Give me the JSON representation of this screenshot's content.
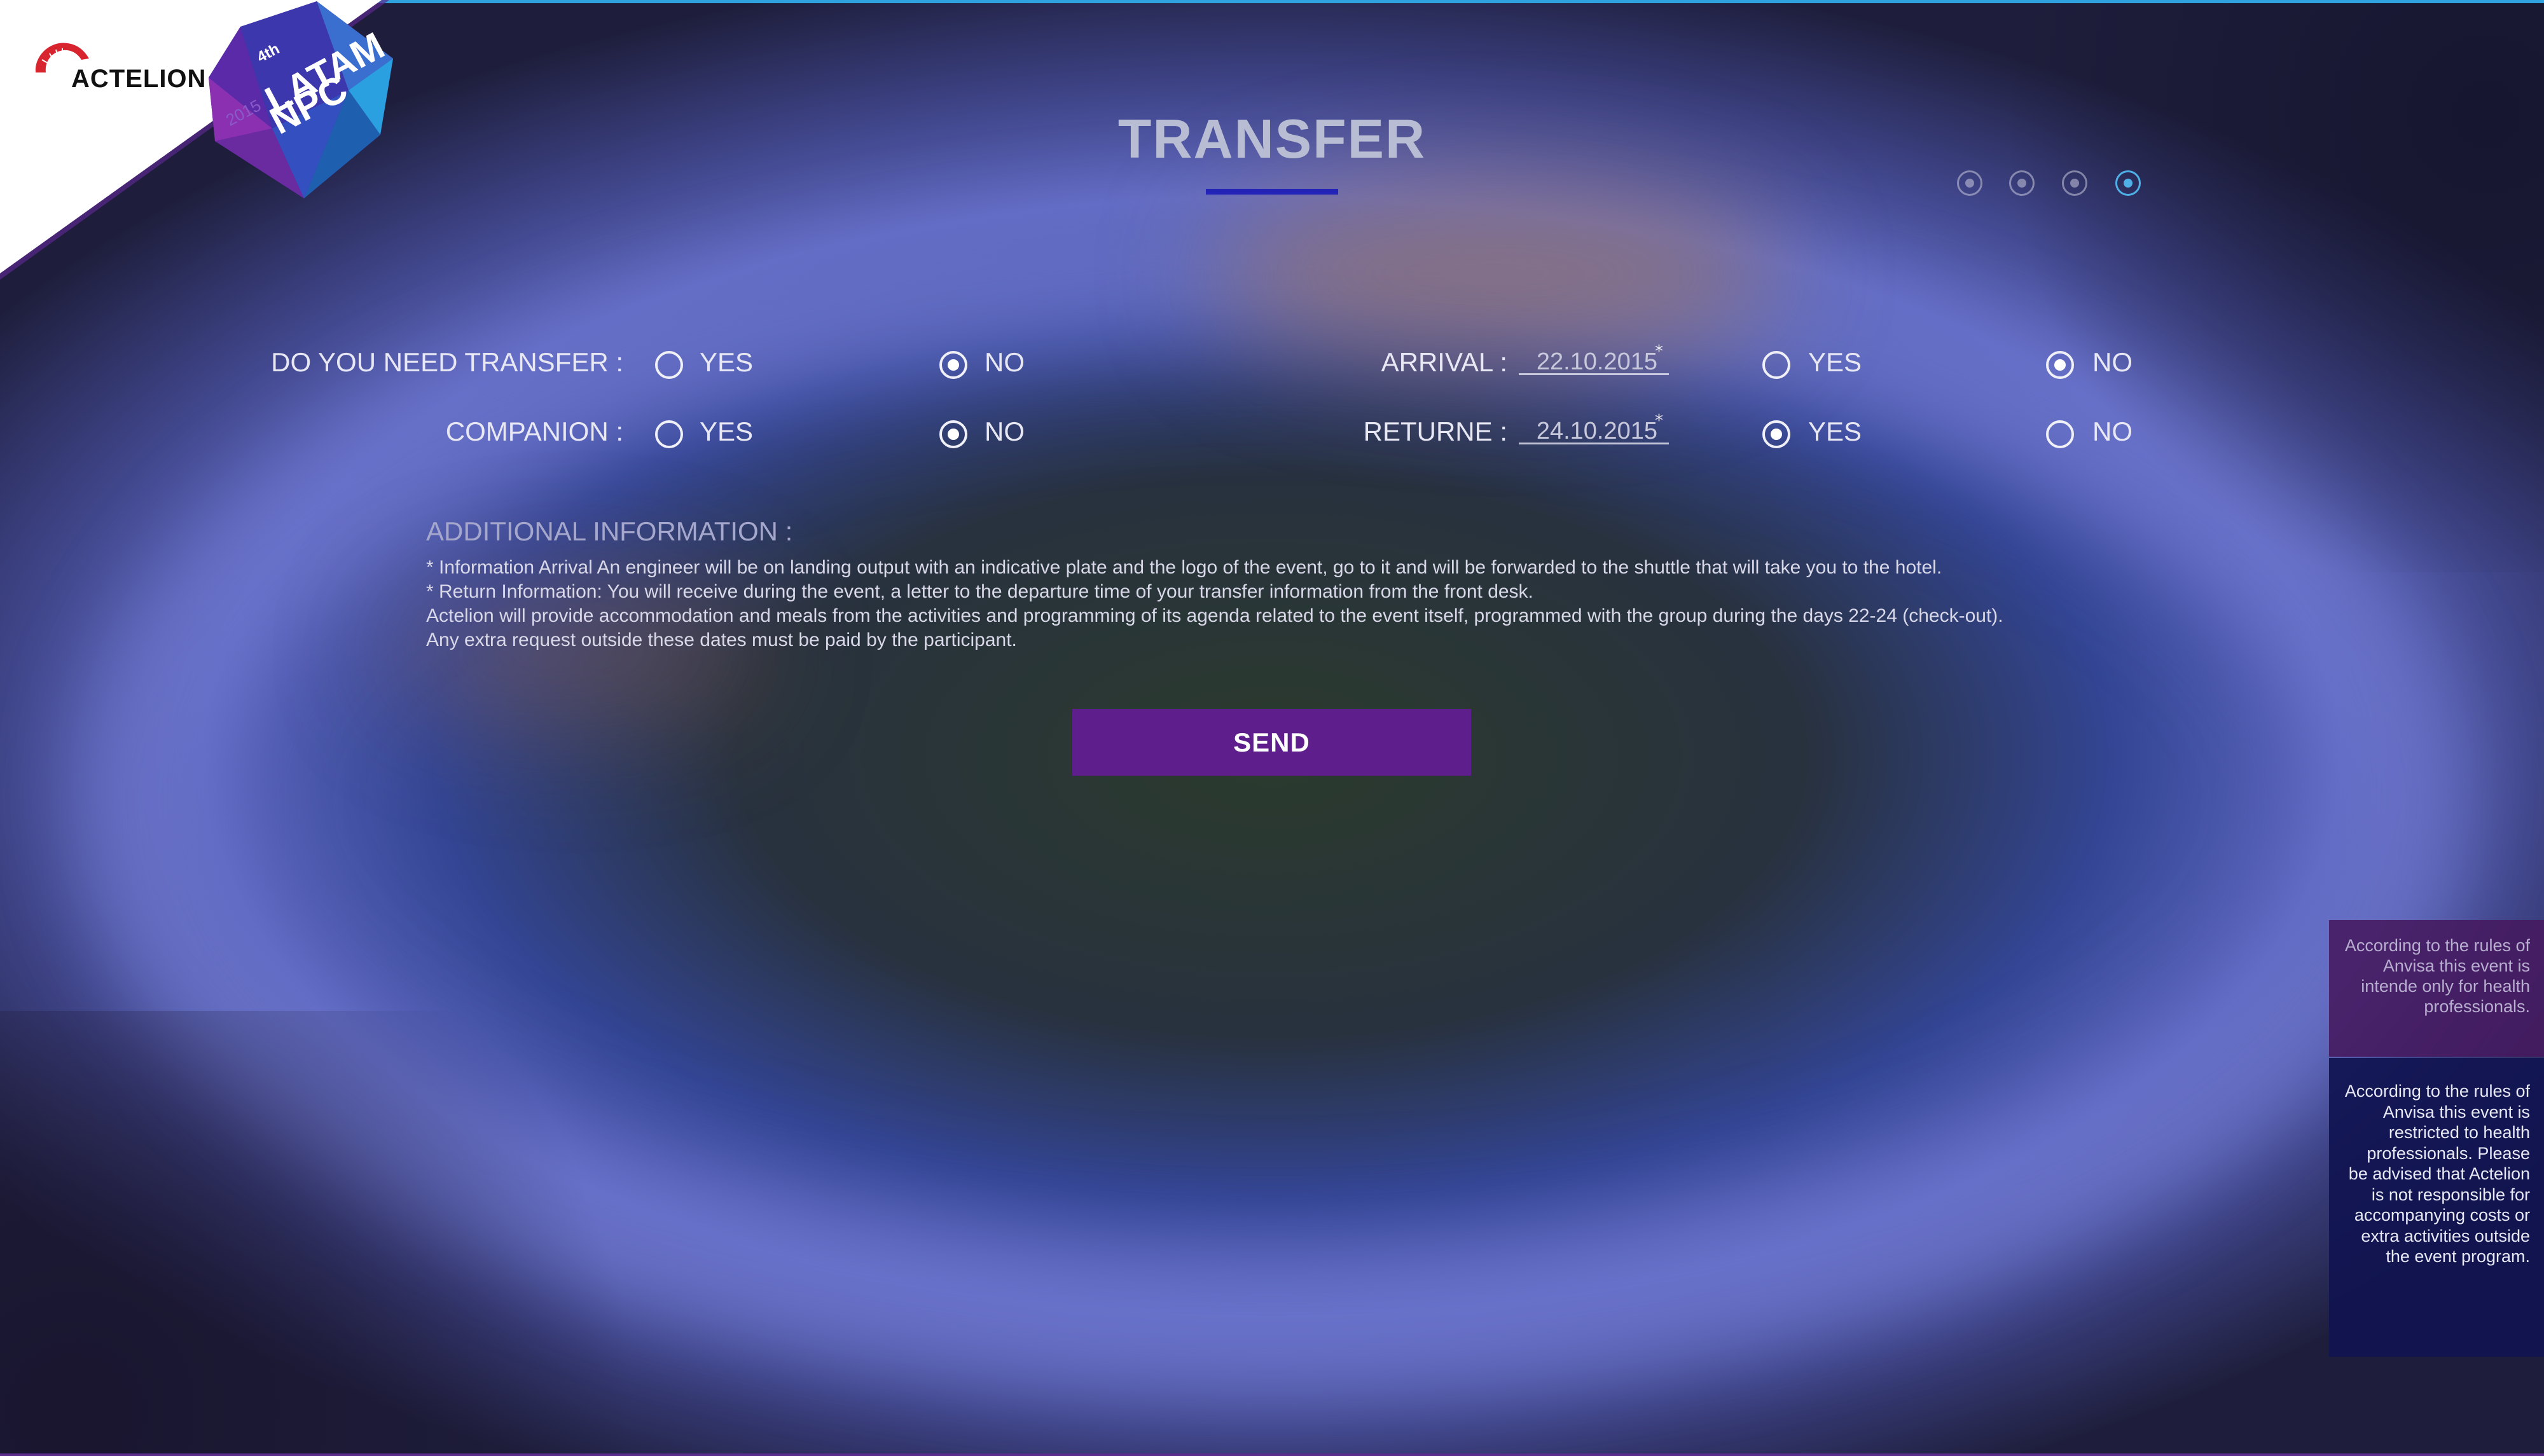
{
  "brand": {
    "company": "ACTELION",
    "event_badge": {
      "edition": "4th",
      "line1": "LATAM",
      "line2": "NPC",
      "year": "2015"
    }
  },
  "page": {
    "title": "TRANSFER"
  },
  "steps": {
    "total": 4,
    "active": 4
  },
  "form": {
    "need_transfer": {
      "label": "DO YOU NEED TRANSFER :",
      "yes": "YES",
      "no": "NO",
      "selected": "NO"
    },
    "companion": {
      "label": "COMPANION :",
      "yes": "YES",
      "no": "NO",
      "selected": "NO"
    },
    "arrival": {
      "label": "ARRIVAL :",
      "date": "22.10.2015",
      "asterisk": "*",
      "yes": "YES",
      "no": "NO",
      "selected": "NO"
    },
    "returne": {
      "label": "RETURNE :",
      "date": "24.10.2015",
      "asterisk": "*",
      "yes": "YES",
      "no": "NO",
      "selected": "YES"
    }
  },
  "additional": {
    "title": "ADDITIONAL INFORMATION :",
    "lines": [
      "* Information Arrival An engineer will be on landing output with an indicative plate and the logo of the event, go to it and will be forwarded to the shuttle that will take you to the hotel.",
      "* Return Information: You will receive during the event, a letter to the departure time of your transfer information from the front desk.",
      "Actelion will provide accommodation and meals from the activities and programming of its agenda related to the event itself, programmed with the group during the days 22-24 (check-out).",
      "Any extra request outside these dates must be paid by the participant."
    ]
  },
  "send_button": {
    "label": "SEND"
  },
  "notices": {
    "short": "According to the rules of Anvisa this event is intende only for health professionals.",
    "long": "According to the rules of Anvisa this event is restricted to health professionals. Please be advised that Actelion is not responsible for accompanying costs or extra activities outside the event program."
  },
  "colors": {
    "accent_blue": "#2fa3e0",
    "title_underline": "#2323b8",
    "send_button": "#5e1f8c",
    "step_active": "#4fb0e8"
  }
}
